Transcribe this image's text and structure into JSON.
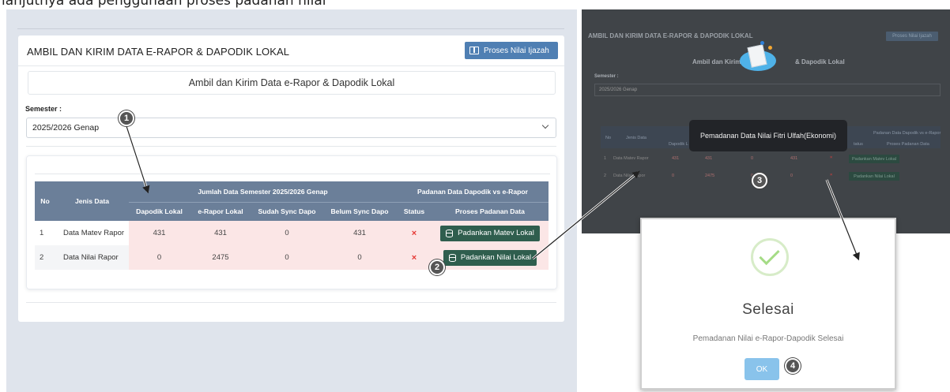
{
  "top_strip_text": "lanjutnya ada penggunaan proses padanan nilai",
  "left": {
    "card_title": "AMBIL DAN KIRIM DATA E-RAPOR & DAPODIK LOKAL",
    "btn_ijazah": "Proses Nilai Ijazah",
    "subtitle": "Ambil dan Kirim Data e-Rapor & Dapodik Lokal",
    "semester_label": "Semester :",
    "semester_value": "2025/2026 Genap",
    "table": {
      "h_no": "No",
      "h_jenis": "Jenis Data",
      "h_jumlah": "Jumlah Data Semester 2025/2026 Genap",
      "h_padanan": "Padanan Data Dapodik vs e-Rapor",
      "h_dapodik": "Dapodik Lokal",
      "h_erapor": "e-Rapor Lokal",
      "h_sudah": "Sudah Sync Dapo",
      "h_belum": "Belum Sync Dapo",
      "h_status": "Status",
      "h_proses": "Proses Padanan Data",
      "rows": [
        {
          "no": "1",
          "jenis": "Data Matev Rapor",
          "dapodik": "431",
          "erapor": "431",
          "sudah": "0",
          "belum": "431",
          "status": "×",
          "btn": "Padankan Matev Lokal"
        },
        {
          "no": "2",
          "jenis": "Data Nilai Rapor",
          "dapodik": "0",
          "erapor": "2475",
          "sudah": "0",
          "belum": "0",
          "status": "×",
          "btn": "Padankan Nilai Lokal"
        }
      ]
    }
  },
  "right": {
    "title": "AMBIL DAN KIRIM DATA E-RAPOR & DAPODIK LOKAL",
    "btn": "Proses Nilai Ijazah",
    "sub_a": "Ambil dan Kirim",
    "sub_b": "& Dapodik Lokal",
    "semester_label": "Semester :",
    "semester_value": "2025/2026 Genap",
    "head_left": "No",
    "head_jenis": "Jenis Data",
    "head_dapodik": "Dapodik L",
    "head_padanan": "Padanan Data Dapodik vs e-Rapor",
    "head_status": "tatus",
    "head_proses": "Proses Padanan Data",
    "row1": {
      "no": "1",
      "jenis": "Data Matev Rapor",
      "a": "431",
      "b": "431",
      "c": "0",
      "d": "431",
      "x": "×",
      "btn": "Padankan Matev Lokal"
    },
    "row2": {
      "no": "2",
      "jenis": "Data Nilai Rapor",
      "a": "0",
      "b": "2475",
      "c": "0",
      "d": "0",
      "x": "×",
      "btn": "Padankan Nilai Lokal"
    },
    "tooltip": "Pemadanan Data Nilai Fitri Ulfah(Ekonomi)"
  },
  "modal": {
    "title": "Selesai",
    "text": "Pemadanan Nilai e-Rapor-Dapodik Selesai",
    "ok": "OK"
  },
  "badges": {
    "b1": "1",
    "b2": "2",
    "b3": "3",
    "b4": "4"
  },
  "colors": {
    "header": "#6b7f99",
    "button_green": "#2f5e4e",
    "accent_blue": "#4f7fb3",
    "error_red": "#e53935"
  }
}
